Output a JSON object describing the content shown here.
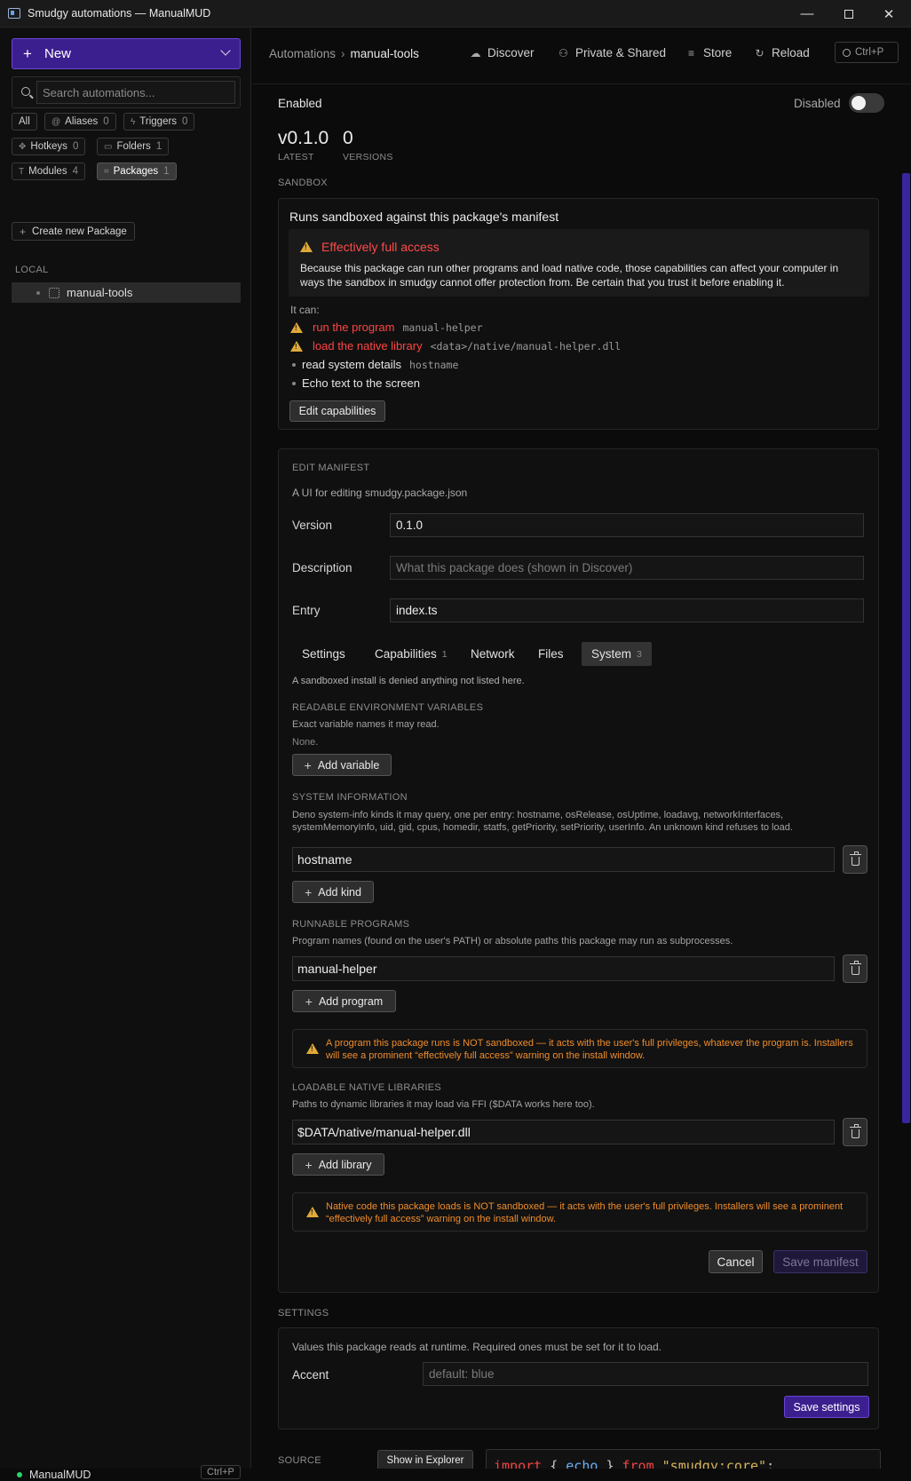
{
  "window": {
    "title": "Smudgy automations — ManualMUD"
  },
  "sidebar": {
    "new_label": "New",
    "search_placeholder": "Search automations...",
    "filters": [
      {
        "label": "All",
        "count": ""
      },
      {
        "label": "Aliases",
        "count": "0"
      },
      {
        "label": "Triggers",
        "count": "0"
      },
      {
        "label": "Hotkeys",
        "count": "0"
      },
      {
        "label": "Folders",
        "count": "1"
      },
      {
        "label": "Modules",
        "count": "4"
      },
      {
        "label": "Packages",
        "count": "1"
      }
    ],
    "create_package": "Create new Package",
    "section_local": "LOCAL",
    "tree_item": "manual-tools",
    "status_name": "ManualMUD",
    "status_shortcut": "Ctrl+P"
  },
  "topbar": {
    "crumb_root": "Automations",
    "crumb_current": "manual-tools",
    "nav": [
      "Discover",
      "Private & Shared",
      "Store",
      "Reload"
    ],
    "command_shortcut": "Ctrl+P"
  },
  "main": {
    "enabled_label": "Enabled",
    "toggle_label": "Disabled",
    "toggle_on": false,
    "stats": [
      {
        "value": "v0.1.0",
        "label": "LATEST"
      },
      {
        "value": "0",
        "label": "VERSIONS"
      }
    ],
    "sandbox": {
      "header": "SANDBOX",
      "title": "Runs sandboxed against this package's manifest",
      "warning_title": "Effectively full access",
      "warning_body": "Because this package can run other programs and load native code, those capabilities can affect your computer in ways the sandbox in smudgy cannot offer protection from. Be certain that you trust it before enabling it.",
      "it_can": "It can:",
      "caps": [
        {
          "text": "run the program",
          "code": "manual-helper",
          "danger": true
        },
        {
          "text": "load the native library",
          "code": "<data>/native/manual-helper.dll",
          "danger": true
        },
        {
          "text": "read system details",
          "code": "hostname",
          "danger": false
        },
        {
          "text": "Echo text to the screen",
          "code": "",
          "danger": false
        }
      ],
      "edit_button": "Edit capabilities"
    },
    "manifest": {
      "header": "EDIT MANIFEST",
      "subtitle": "A UI for editing smudgy.package.json",
      "version_label": "Version",
      "version_value": "0.1.0",
      "description_label": "Description",
      "description_placeholder": "What this package does (shown in Discover)",
      "entry_label": "Entry",
      "entry_value": "index.ts",
      "tabs": [
        {
          "label": "Settings",
          "count": ""
        },
        {
          "label": "Capabilities",
          "count": "1"
        },
        {
          "label": "Network",
          "count": ""
        },
        {
          "label": "Files",
          "count": ""
        },
        {
          "label": "System",
          "count": "3"
        }
      ],
      "deny_note": "A sandboxed install is denied anything not listed here.",
      "env": {
        "header": "READABLE ENVIRONMENT VARIABLES",
        "desc": "Exact variable names it may read.",
        "empty": "None.",
        "add": "Add variable"
      },
      "sysinfo": {
        "header": "SYSTEM INFORMATION",
        "desc": "Deno system-info kinds it may query, one per entry: hostname, osRelease, osUptime, loadavg, networkInterfaces, systemMemoryInfo, uid, gid, cpus, homedir, statfs, getPriority, setPriority, userInfo. An unknown kind refuses to load.",
        "value": "hostname",
        "add": "Add kind"
      },
      "programs": {
        "header": "RUNNABLE PROGRAMS",
        "desc": "Program names (found on the user's PATH) or absolute paths this package may run as subprocesses.",
        "value": "manual-helper",
        "add": "Add program",
        "warning": "A program this package runs is NOT sandboxed — it acts with the user's full privileges, whatever the program is. Installers will see a prominent “effectively full access” warning on the install window."
      },
      "libraries": {
        "header": "LOADABLE NATIVE LIBRARIES",
        "desc": "Paths to dynamic libraries it may load via FFI ($DATA works here too).",
        "value": "$DATA/native/manual-helper.dll",
        "add": "Add library",
        "warning": "Native code this package loads is NOT sandboxed — it acts with the user's full privileges. Installers will see a prominent “effectively full access” warning on the install window."
      },
      "cancel": "Cancel",
      "save": "Save manifest"
    },
    "settings": {
      "header": "SETTINGS",
      "desc": "Values this package reads at runtime. Required ones must be set for it to load.",
      "accent_label": "Accent",
      "accent_placeholder": "default: blue",
      "save": "Save settings"
    },
    "source": {
      "header": "SOURCE",
      "show_button": "Show in Explorer",
      "code_kw1": "import",
      "code_brace_open": "{",
      "code_ident": "echo",
      "code_brace_close": "}",
      "code_kw2": "from",
      "code_str": "\"smudgy:core\"",
      "code_end": ";"
    }
  }
}
